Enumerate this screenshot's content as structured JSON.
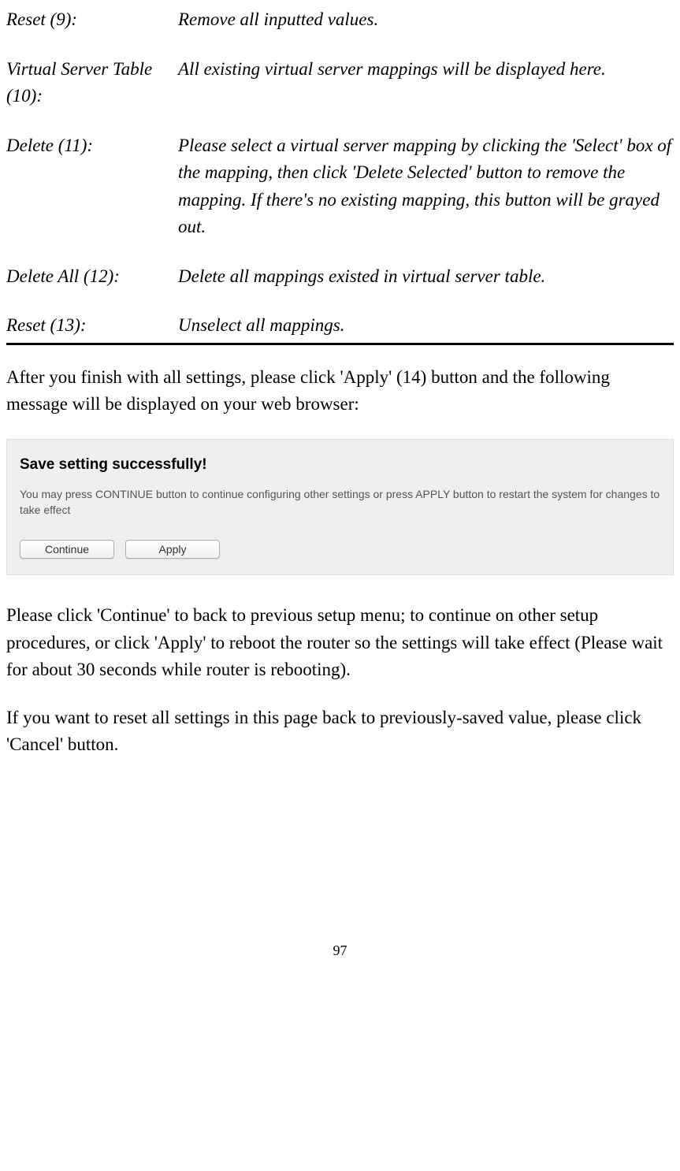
{
  "definitions": [
    {
      "term": "Reset (9):",
      "desc": "Remove all inputted values."
    },
    {
      "term": "Virtual Server Table (10):",
      "desc": "All existing virtual server mappings will be displayed here."
    },
    {
      "term": "Delete (11):",
      "desc": "Please select a virtual server mapping by clicking the 'Select' box of the mapping, then click 'Delete Selected' button to remove the mapping. If there's no existing mapping, this button will be grayed out."
    },
    {
      "term": "Delete All (12):",
      "desc": "Delete all mappings existed in virtual server table."
    },
    {
      "term": "Reset (13):",
      "desc": "Unselect all mappings."
    }
  ],
  "paragraph1": "After you finish with all settings, please click 'Apply' (14) button and the following message will be displayed on your web browser:",
  "dialog": {
    "title": "Save setting successfully!",
    "text": "You may press CONTINUE button to continue configuring other settings or press APPLY button to restart the system for changes to take effect",
    "continue_label": "Continue",
    "apply_label": "Apply"
  },
  "paragraph2": "Please click 'Continue' to back to previous setup menu; to continue on other setup procedures, or click 'Apply' to reboot the router so the settings will take effect (Please wait for about 30 seconds while router is rebooting).",
  "paragraph3": "If you want to reset all settings in this page back to previously-saved value, please click 'Cancel' button.",
  "page_number": "97"
}
